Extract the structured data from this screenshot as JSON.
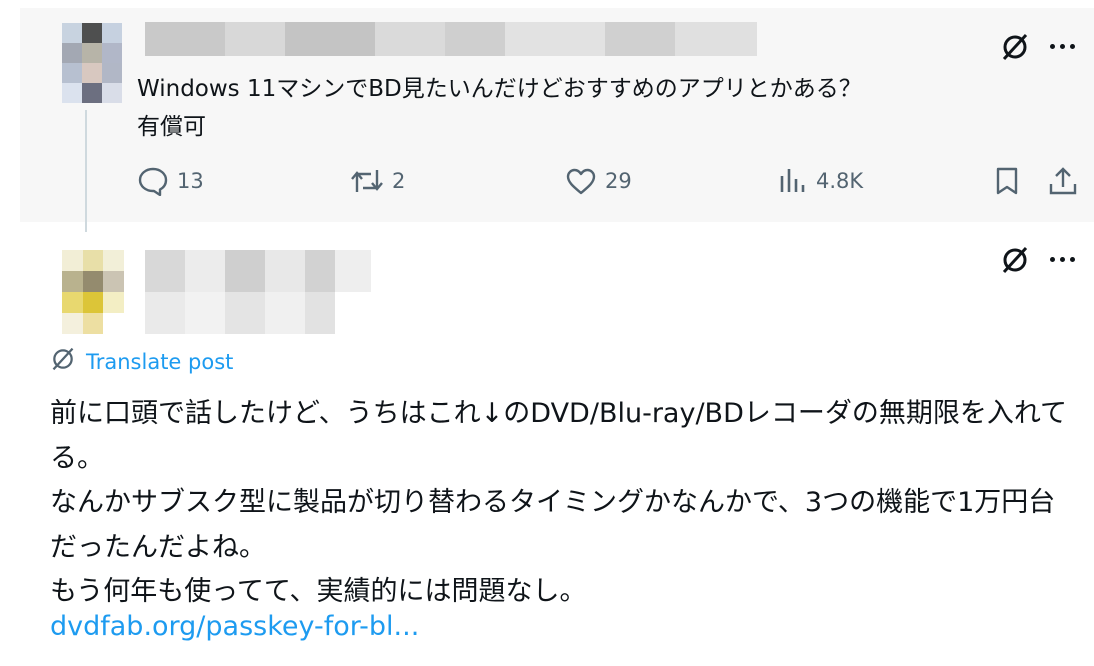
{
  "original_post": {
    "text": "Windows 11マシンでBD見たいんだけどおすすめのアプリとかある？\n有償可",
    "actions": {
      "reply_count": "13",
      "repost_count": "2",
      "like_count": "29",
      "view_count": "4.8K"
    }
  },
  "reply_post": {
    "translate_label": "Translate post",
    "text": "前に口頭で話したけど、うちはこれ↓のDVD/Blu-ray/BDレコーダの無期限を入れてる。\nなんかサブスク型に製品が切り替わるタイミングかなんかで、3つの機能で1万円台だったんだよね。\nもう何年も使ってて、実績的には問題なし。",
    "link_text": "dvdfab.org/passkey-for-bl..."
  },
  "colors": {
    "accent_blue": "#1d9bf0",
    "icon_gray": "#536471",
    "text_primary": "#0f1419",
    "highlight_bg": "#f7f7f7"
  },
  "icons": [
    "grok-icon",
    "more-icon",
    "reply-icon",
    "repost-icon",
    "like-icon",
    "views-icon",
    "bookmark-icon",
    "share-icon",
    "translate-icon"
  ]
}
